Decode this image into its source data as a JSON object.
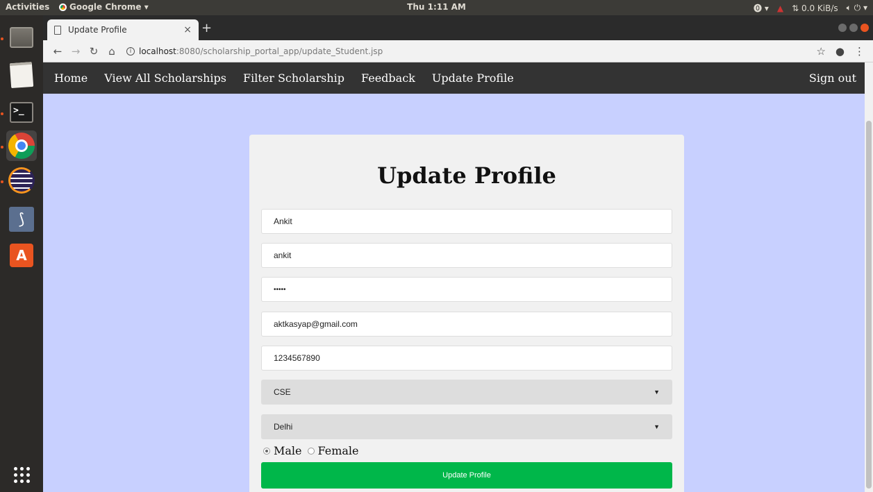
{
  "system_bar": {
    "activities": "Activities",
    "app_name": "Google Chrome ▾",
    "clock": "Thu  1:11 AM",
    "network_speed": "0.0 KiB/s"
  },
  "browser": {
    "tab_title": "Update Profile",
    "url_host": "localhost",
    "url_path": ":8080/scholarship_portal_app/update_Student.jsp"
  },
  "navbar": {
    "items": [
      "Home",
      "View All Scholarships",
      "Filter Scholarship",
      "Feedback",
      "Update Profile"
    ],
    "sign_out": "Sign out"
  },
  "form": {
    "title": "Update Profile",
    "name": "Ankit",
    "username": "ankit",
    "password_masked": "•••••",
    "email": "aktkasyap@gmail.com",
    "phone": "1234567890",
    "branch": "CSE",
    "city": "Delhi",
    "gender_options": [
      "Male",
      "Female"
    ],
    "gender_selected": "Male",
    "submit_label": "Update Profile"
  },
  "colors": {
    "page_background": "#c8d0ff",
    "navbar": "#333333",
    "submit_button": "#00b74a"
  }
}
